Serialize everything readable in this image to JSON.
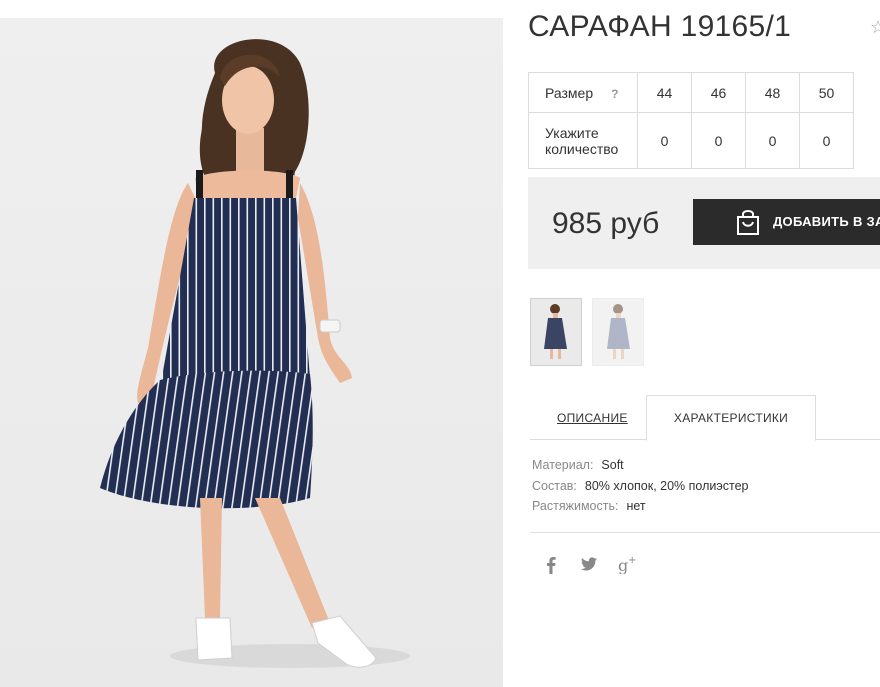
{
  "product": {
    "title": "САРАФАН 19165/1",
    "price": "985 руб",
    "add_to_cart_label": "ДОБАВИТЬ В ЗАКАЗ"
  },
  "sizes": {
    "size_label": "Размер",
    "help_label": "?",
    "qty_label_line1": "Укажите",
    "qty_label_line2": "количество",
    "items": [
      {
        "size": "44",
        "qty": "0"
      },
      {
        "size": "46",
        "qty": "0"
      },
      {
        "size": "48",
        "qty": "0"
      },
      {
        "size": "50",
        "qty": "0"
      }
    ]
  },
  "tabs": {
    "description": "ОПИСАНИЕ",
    "characteristics": "ХАРАКТЕРИСТИКИ"
  },
  "specs": [
    {
      "key": "Материал:",
      "value": "Soft"
    },
    {
      "key": "Состав:",
      "value": "80% хлопок, 20% полиэстер"
    },
    {
      "key": "Растяжимость:",
      "value": "нет"
    }
  ],
  "social": {
    "facebook": "f",
    "twitter": "twitter-icon",
    "google": "g+"
  },
  "colors": {
    "dress": "#232f52",
    "button": "#2b2b2b",
    "price_bg": "#efefef"
  }
}
